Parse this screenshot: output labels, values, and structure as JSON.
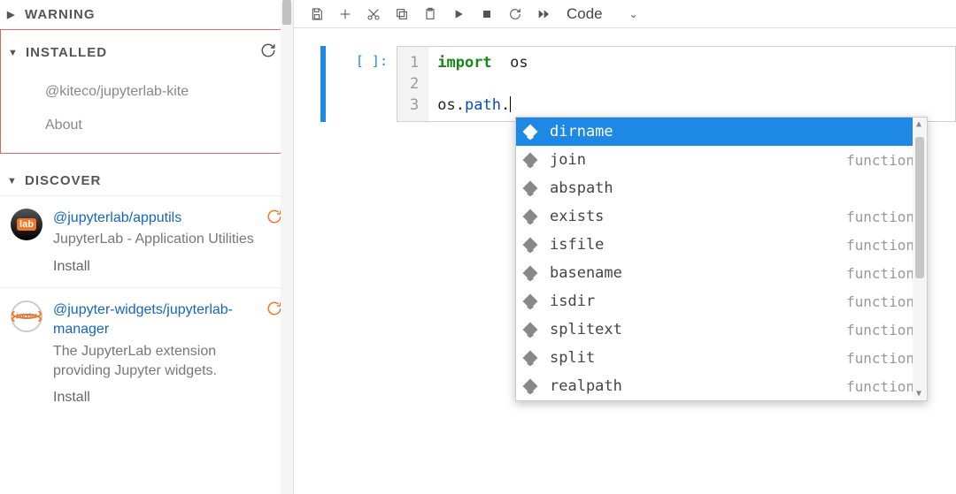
{
  "sidebar": {
    "sections": {
      "warning": {
        "label": "WARNING"
      },
      "installed": {
        "label": "INSTALLED",
        "items": [
          {
            "label": "@kiteco/jupyterlab-kite"
          },
          {
            "label": "About"
          }
        ]
      },
      "discover": {
        "label": "DISCOVER",
        "items": [
          {
            "title": "@jupyterlab/apputils",
            "desc": "JupyterLab - Application Utilities",
            "action": "Install",
            "icon": "lab"
          },
          {
            "title": "@jupyter-widgets/jupyterlab-manager",
            "desc": "The JupyterLab extension providing Jupyter widgets.",
            "action": "Install",
            "icon": "jupyter"
          }
        ]
      }
    }
  },
  "toolbar": {
    "buttons": [
      "save",
      "add",
      "cut",
      "copy",
      "paste",
      "run",
      "stop",
      "restart",
      "fast-forward"
    ],
    "cell_type": "Code"
  },
  "cell": {
    "prompt": "[ ]:",
    "gutter": [
      "1",
      "2",
      "3"
    ],
    "code": {
      "line1_keyword": "import",
      "line1_module": "os",
      "line3_obj": "os",
      "line3_attr": "path",
      "line3_dot": "."
    }
  },
  "autocomplete": {
    "selected_index": 0,
    "items": [
      {
        "name": "dirname",
        "kind": ""
      },
      {
        "name": "join",
        "kind": "function"
      },
      {
        "name": "abspath",
        "kind": ""
      },
      {
        "name": "exists",
        "kind": "function"
      },
      {
        "name": "isfile",
        "kind": "function"
      },
      {
        "name": "basename",
        "kind": "function"
      },
      {
        "name": "isdir",
        "kind": "function"
      },
      {
        "name": "splitext",
        "kind": "function"
      },
      {
        "name": "split",
        "kind": "function"
      },
      {
        "name": "realpath",
        "kind": "function"
      }
    ]
  }
}
